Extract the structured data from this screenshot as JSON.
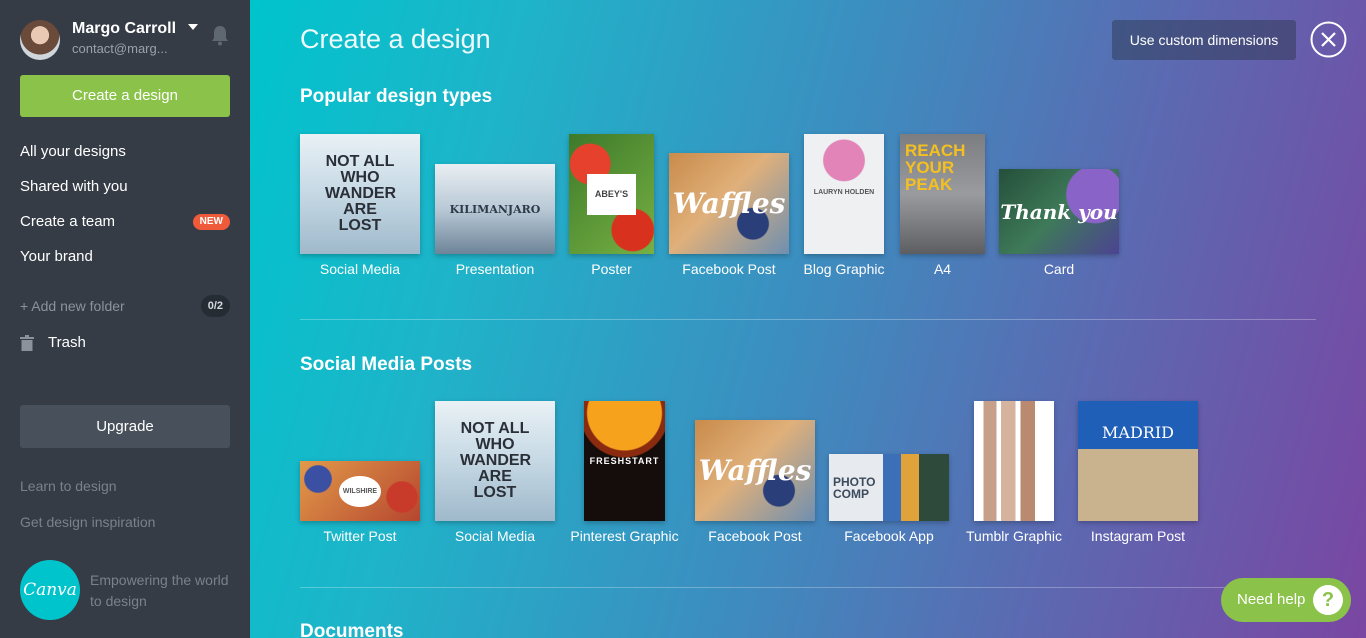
{
  "user": {
    "name": "Margo Carroll",
    "email": "contact@marg..."
  },
  "sidebar": {
    "create_label": "Create a design",
    "nav": [
      {
        "label": "All your designs"
      },
      {
        "label": "Shared with you"
      },
      {
        "label": "Create a team",
        "badge": "NEW"
      },
      {
        "label": "Your brand"
      }
    ],
    "add_folder": "+ Add new folder",
    "folder_count": "0/2",
    "trash": "Trash",
    "upgrade": "Upgrade",
    "learn": "Learn to design",
    "inspiration": "Get design inspiration",
    "logo_text": "Canva",
    "tagline": "Empowering the world to design"
  },
  "main": {
    "title": "Create a design",
    "custom_dimensions": "Use custom dimensions",
    "sections": [
      {
        "title": "Popular design types",
        "items": [
          {
            "label": "Social Media",
            "thumb_text": "NOT ALL WHO WANDER ARE LOST"
          },
          {
            "label": "Presentation",
            "thumb_text": "KILIMANJARO"
          },
          {
            "label": "Poster",
            "thumb_text": "ABEY'S"
          },
          {
            "label": "Facebook Post",
            "thumb_text": "Waffles"
          },
          {
            "label": "Blog Graphic",
            "thumb_text": "LAURYN HOLDEN"
          },
          {
            "label": "A4",
            "thumb_text": "REACH YOUR PEAK"
          },
          {
            "label": "Card",
            "thumb_text": "Thank you"
          }
        ]
      },
      {
        "title": "Social Media Posts",
        "items": [
          {
            "label": "Twitter Post",
            "thumb_text": "WILSHIRE"
          },
          {
            "label": "Social Media",
            "thumb_text": "NOT ALL WHO WANDER ARE LOST"
          },
          {
            "label": "Pinterest Graphic",
            "thumb_text": "FRESHSTART"
          },
          {
            "label": "Facebook Post",
            "thumb_text": "Waffles"
          },
          {
            "label": "Facebook App",
            "thumb_text": "PHOTO COMP"
          },
          {
            "label": "Tumblr Graphic",
            "thumb_text": ""
          },
          {
            "label": "Instagram Post",
            "thumb_text": "MADRID"
          }
        ]
      },
      {
        "title": "Documents"
      }
    ]
  },
  "help": {
    "label": "Need help",
    "icon": "?"
  }
}
